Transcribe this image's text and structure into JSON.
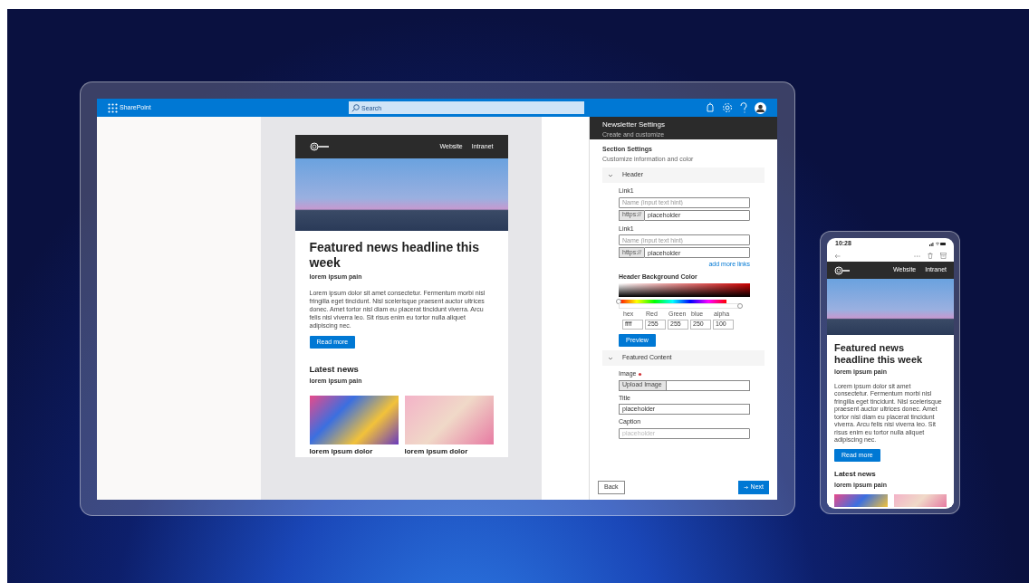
{
  "desktop": {
    "app_name": "SharePoint",
    "search": {
      "placeholder": "Search"
    },
    "newsletter": {
      "nav_links": [
        "Website",
        "Intranet"
      ],
      "headline": "Featured news headline this week",
      "subtitle": "lorem ipsum pain",
      "body": "Lorem ipsum dolor sit amet consectetur. Fermentum morbi nisl fringilla eget tincidunt. Nisl scelerisque praesent auctor ultrices donec. Amet tortor nisl diam eu placerat tincidunt viverra. Arcu felis nisi viverra leo. Sit risus enim eu tortor nulla aliquet adipiscing nec.",
      "button": "Read more",
      "latest_title": "Latest news",
      "latest_subtitle": "lorem ipsum pain",
      "cards": [
        {
          "title": "lorem ipsum dolor"
        },
        {
          "title": "lorem ipsum dolor"
        }
      ]
    }
  },
  "settings": {
    "title": "Newsletter Settings",
    "subtitle": "Create and customize",
    "section_title": "Section Settings",
    "section_subtitle": "Customize information and color",
    "header_group": {
      "label": "Header",
      "expanded": true,
      "links": [
        {
          "label": "Link1",
          "name_placeholder": "Name (input text hint)",
          "prefix": "https://",
          "url_placeholder": "placeholder"
        },
        {
          "label": "Link1",
          "name_placeholder": "Name (input text hint)",
          "prefix": "https://",
          "url_placeholder": "placeholder"
        }
      ],
      "add_link": "add more links",
      "color_label": "Header Background Color",
      "hue": {
        "level": 0
      },
      "alpha": {
        "level": 1
      },
      "color_fields": [
        {
          "label": "hex",
          "value": "ffff"
        },
        {
          "label": "Red",
          "value": "255"
        },
        {
          "label": "Green",
          "value": "255"
        },
        {
          "label": "blue",
          "value": "250"
        },
        {
          "label": "alpha",
          "value": "100"
        }
      ],
      "preview": "Preview"
    },
    "content_group": {
      "label": "Featured Content",
      "expanded": true,
      "image_label": "Image",
      "required": true,
      "upload": "Upload Image",
      "title_label": "Title",
      "title_value": "placeholder",
      "caption_label": "Caption",
      "caption_placeholder": "placeholder"
    },
    "back": "Back",
    "next": "Next"
  },
  "phone": {
    "time": "10:28",
    "nav_links": [
      "Website",
      "Intranet"
    ],
    "headline": "Featured news headline this week",
    "subtitle": "lorem ipsum pain",
    "body": "Lorem ipsum dolor sit amet consectetur. Fermentum morbi nisl fringilla eget tincidunt. Nisl scelerisque praesent auctor ultrices donec. Amet tortor nisl diam eu placerat tincidunt viverra. Arcu felis nisi viverra leo. Sit risus enim eu tortor nulla aliquet adipiscing nec.",
    "button": "Read more",
    "latest_title": "Latest news",
    "latest_subtitle": "lorem ipsum pain"
  }
}
